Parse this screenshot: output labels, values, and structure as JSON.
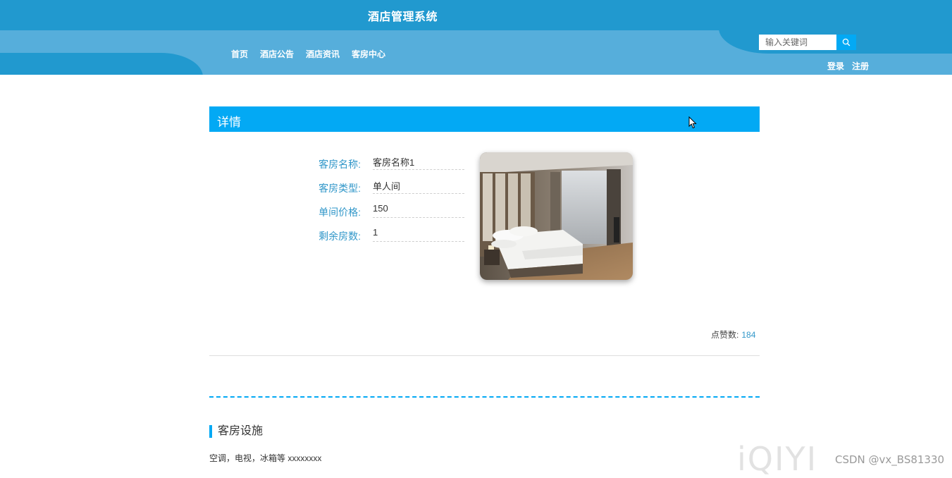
{
  "header": {
    "site_title": "酒店管理系统",
    "nav": [
      "首页",
      "酒店公告",
      "酒店资讯",
      "客房中心"
    ],
    "search": {
      "placeholder": "输入关键词",
      "icon": "search-icon"
    },
    "login_label": "登录",
    "register_label": "注册",
    "colors": {
      "dark": "#2199cf",
      "light": "#56aedb",
      "accent": "#03a9f4"
    }
  },
  "detail": {
    "section_title": "详情",
    "fields": [
      {
        "label": "客房名称:",
        "value": "客房名称1"
      },
      {
        "label": "客房类型:",
        "value": "单人间"
      },
      {
        "label": "单间价格:",
        "value": "150"
      },
      {
        "label": "剩余房数:",
        "value": "1"
      }
    ],
    "likes_label": "点赞数:",
    "likes_count": "184"
  },
  "facility": {
    "title": "客房设施",
    "content": "空调，电视，冰箱等 xxxxxxxx"
  },
  "watermarks": {
    "video": "iQIYI",
    "csdn": "CSDN @vx_BS81330"
  }
}
